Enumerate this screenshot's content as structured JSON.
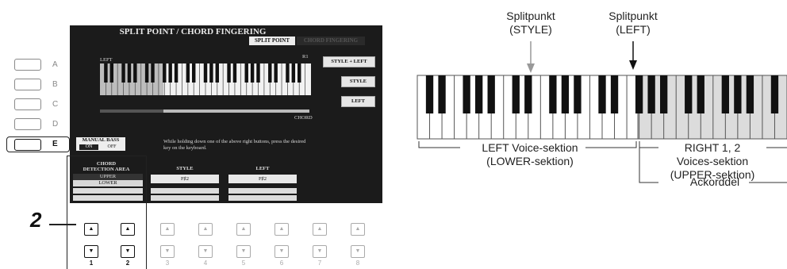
{
  "side_buttons": [
    {
      "letter": "A"
    },
    {
      "letter": "B"
    },
    {
      "letter": "C"
    },
    {
      "letter": "D"
    },
    {
      "letter": "E"
    }
  ],
  "screen": {
    "title": "SPLIT POINT / CHORD FINGERING",
    "tabs": {
      "active": "SPLIT POINT",
      "inactive": "CHORD FINGERING"
    },
    "keyboard_left_label": "LEFT",
    "keyboard_right_label": "R1",
    "chord_label": "CHORD",
    "right_buttons": [
      "STYLE + LEFT",
      "STYLE",
      "LEFT"
    ],
    "manual_bass": {
      "label": "MANUAL BASS",
      "on": "ON",
      "off": "OFF"
    },
    "instruction": "While holding down one of the above right buttons, press the desired key on the keyboard.",
    "chord_detection": {
      "title_line1": "CHORD",
      "title_line2": "DETECTION AREA",
      "upper": "UPPER",
      "lower": "LOWER"
    },
    "style": {
      "title": "STYLE",
      "value": "F♯2"
    },
    "left": {
      "title": "LEFT",
      "value": "F♯2"
    }
  },
  "step_number": "2",
  "bottom_buttons": [
    "1",
    "2",
    "3",
    "4",
    "5",
    "6",
    "7",
    "8"
  ],
  "arrows": {
    "up": "▲",
    "down": "▼"
  },
  "diagram": {
    "split_style_line1": "Splitpunkt",
    "split_style_line2": "(STYLE)",
    "split_left_line1": "Splitpunkt",
    "split_left_line2": "(LEFT)",
    "left_section_line1": "LEFT Voice-sektion",
    "left_section_line2": "(LOWER-sektion)",
    "right_section_line1": "RIGHT 1, 2",
    "right_section_line2": "Voices-sektion",
    "right_section_line3": "(UPPER-sektion)",
    "chord_section": "Ackorddel"
  }
}
